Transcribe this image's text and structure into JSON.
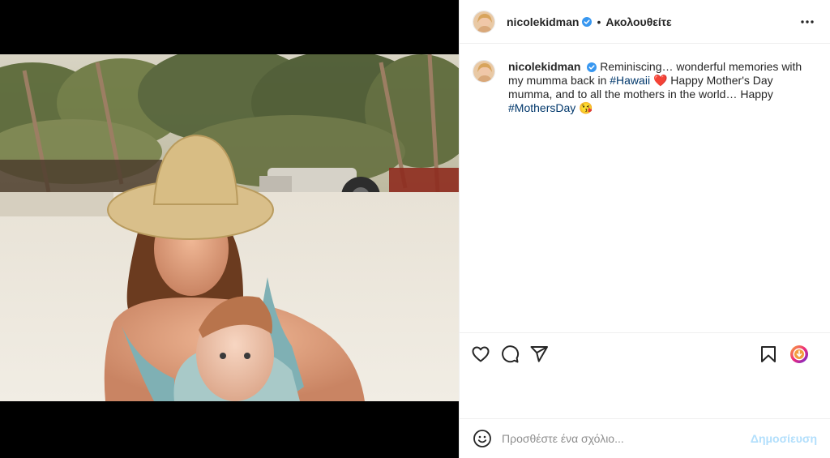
{
  "post": {
    "author": {
      "username": "nicolekidman",
      "verified": true,
      "follow_status": "Ακολουθείτε"
    },
    "header_icons": {
      "more": "more-dots-icon"
    },
    "caption": {
      "username": "nicolekidman",
      "text_part1": "Reminiscing… wonderful memories with my mumma back in ",
      "hashtag1": "#Hawaii",
      "emoji1": "❤️",
      "text_part2": " Happy Mother's Day mumma, and to all the mothers in the world… Happy ",
      "hashtag2": "#MothersDay",
      "emoji2": "😘"
    },
    "actions": {
      "like": "heart-icon",
      "comment": "comment-icon",
      "share": "share-icon",
      "save": "bookmark-icon",
      "extension": "extension-icon"
    },
    "comment_box": {
      "emoji": "emoji-icon",
      "placeholder": "Προσθέστε ένα σχόλιο...",
      "publish_label": "Δημοσίευση"
    },
    "colors": {
      "hashtag": "#00376b",
      "publish_disabled": "#b2dffc",
      "verified": "#3897f0"
    }
  }
}
